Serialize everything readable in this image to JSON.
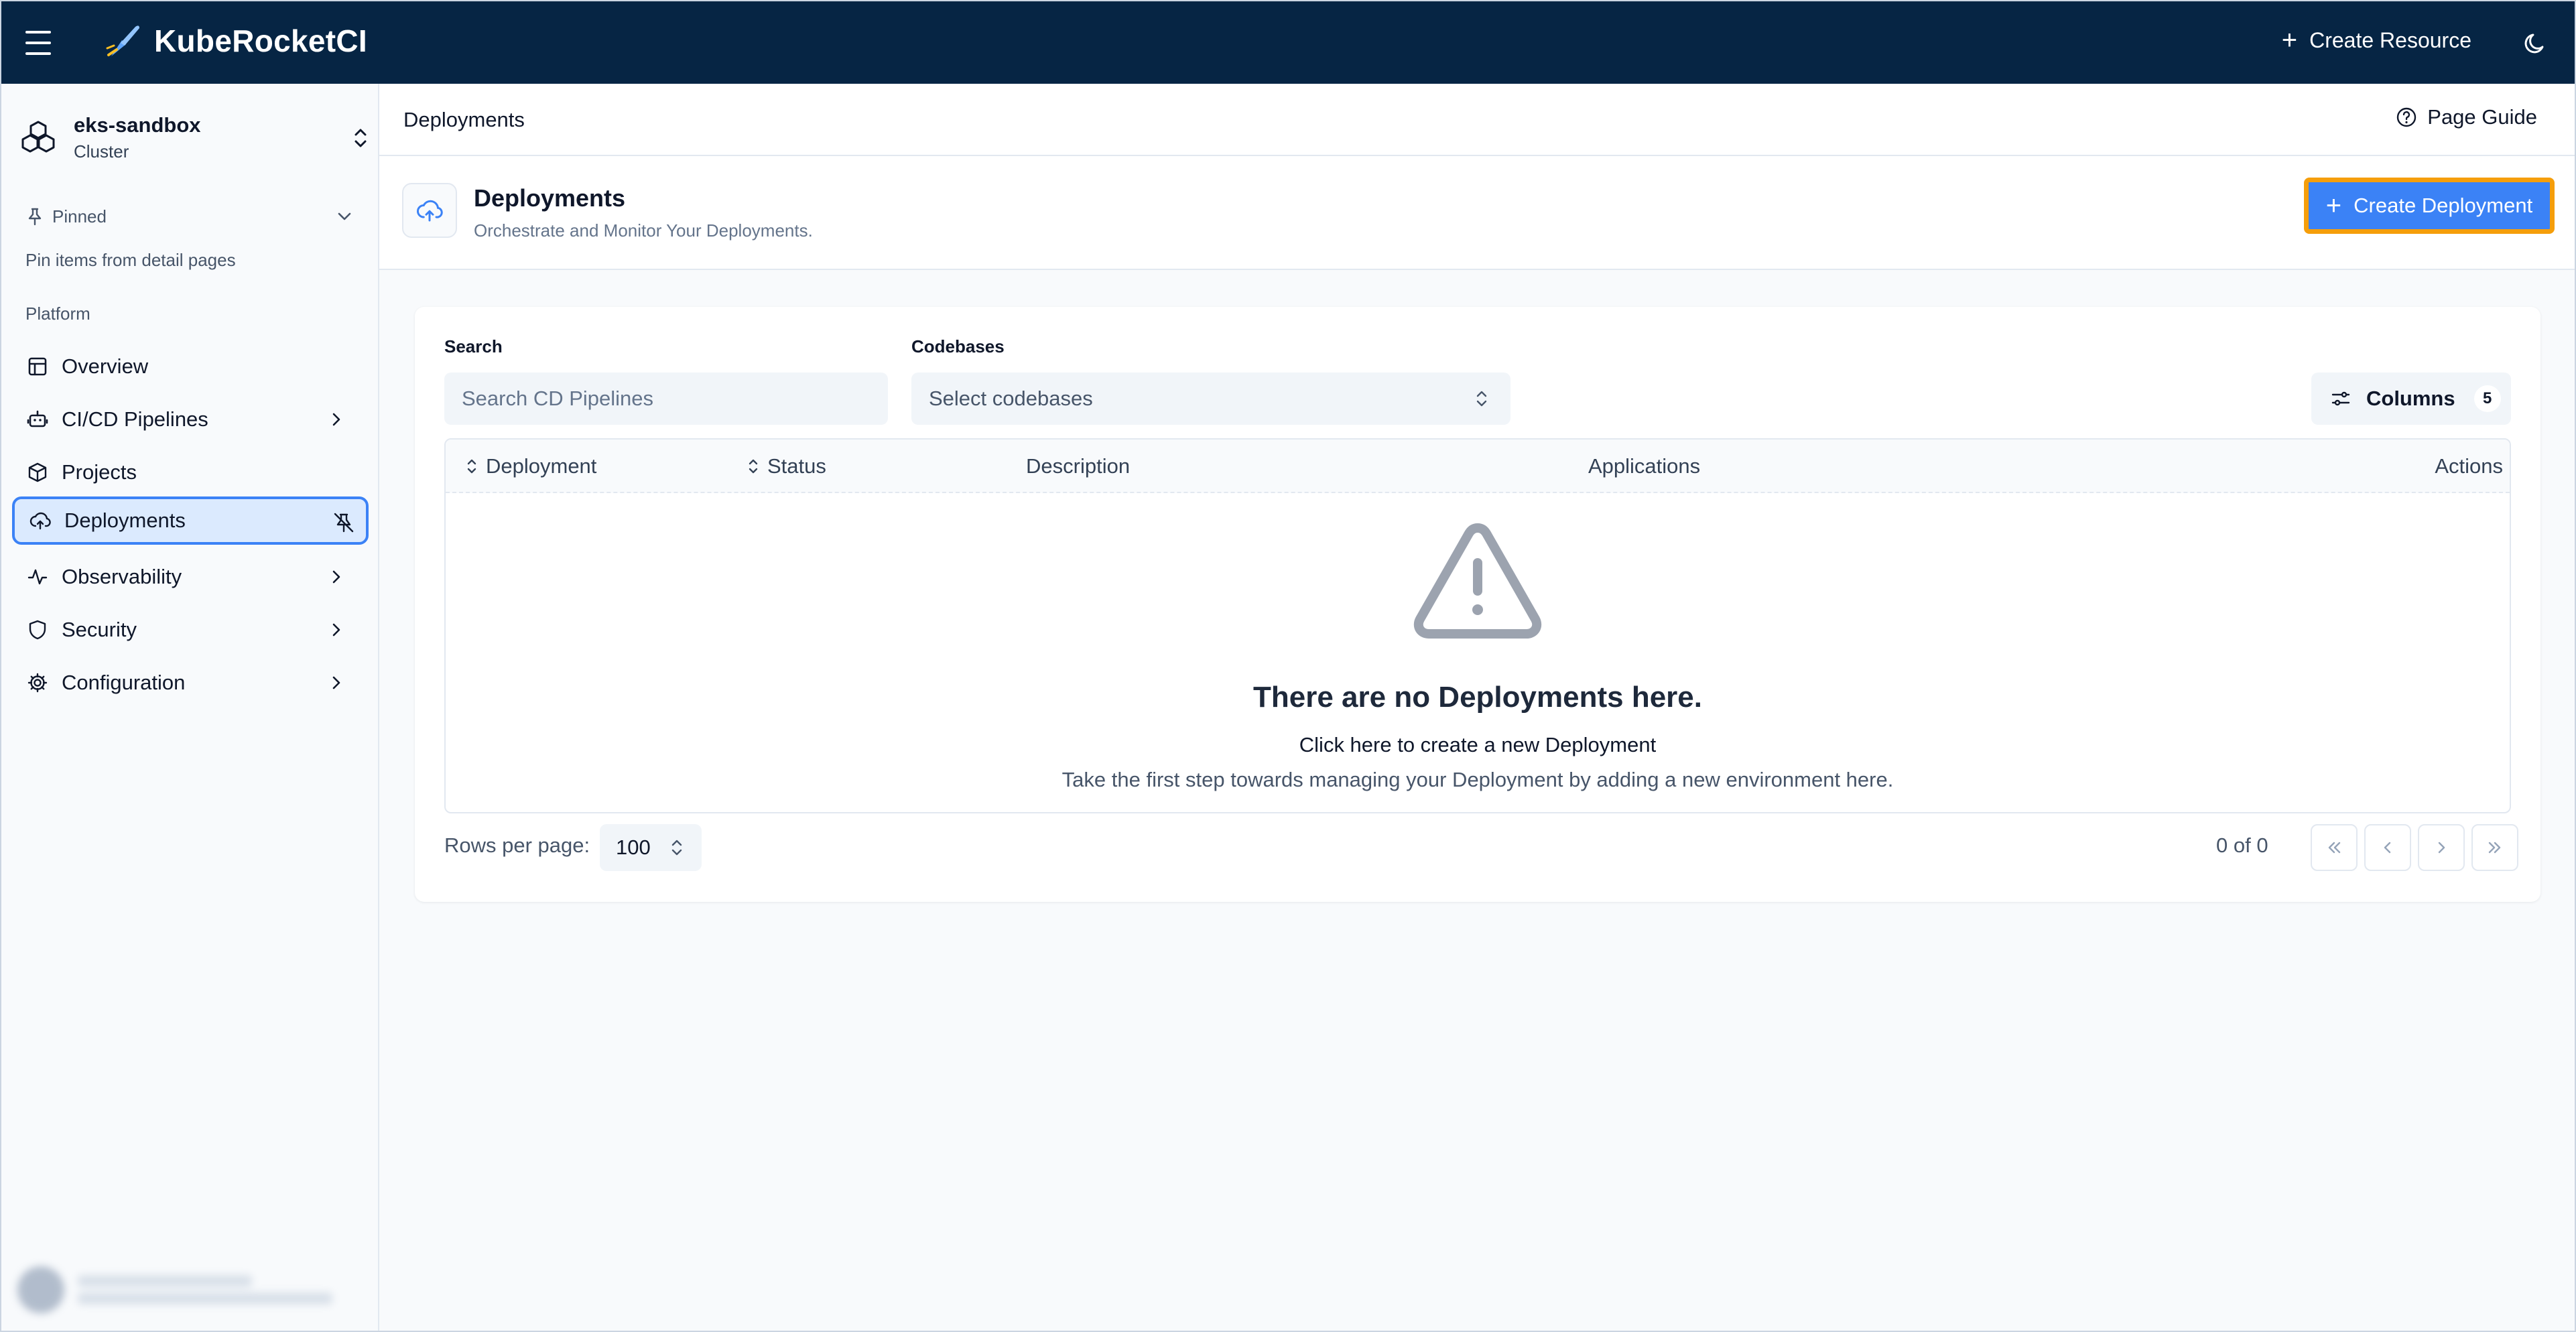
{
  "app": {
    "name": "KubeRocketCI",
    "create_resource": "Create Resource"
  },
  "cluster": {
    "name": "eks-sandbox",
    "type": "Cluster"
  },
  "sidebar": {
    "pinned_label": "Pinned",
    "pinned_hint": "Pin items from detail pages",
    "section": "Platform",
    "items": [
      {
        "label": "Overview"
      },
      {
        "label": "CI/CD Pipelines"
      },
      {
        "label": "Projects"
      },
      {
        "label": "Deployments"
      },
      {
        "label": "Observability"
      },
      {
        "label": "Security"
      },
      {
        "label": "Configuration"
      }
    ]
  },
  "breadcrumb": {
    "current": "Deployments"
  },
  "page_guide": "Page Guide",
  "header": {
    "title": "Deployments",
    "subtitle": "Orchestrate and Monitor Your Deployments.",
    "create_button": "Create Deployment"
  },
  "filters": {
    "search_label": "Search",
    "search_placeholder": "Search CD Pipelines",
    "codebases_label": "Codebases",
    "codebases_placeholder": "Select codebases",
    "columns_label": "Columns",
    "columns_count": "5"
  },
  "table": {
    "headers": [
      "Deployment",
      "Status",
      "Description",
      "Applications",
      "Actions"
    ]
  },
  "empty": {
    "title": "There are no Deployments here.",
    "link": "Click here to create a new Deployment",
    "hint": "Take the first step towards managing your Deployment by adding a new environment here."
  },
  "pagination": {
    "rows_label": "Rows per page:",
    "rows_value": "100",
    "range": "0 of 0"
  },
  "colors": {
    "topbar": "#062544",
    "accent": "#3b82f6",
    "focus_outline": "#f59e0b"
  }
}
